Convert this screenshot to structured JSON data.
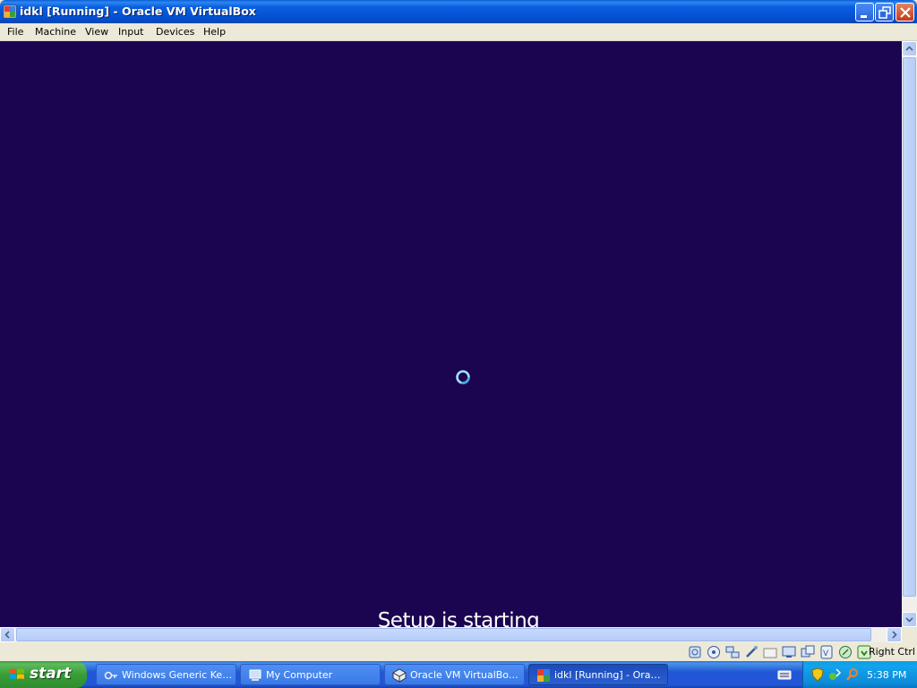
{
  "window": {
    "title": "idkl [Running] - Oracle VM VirtualBox",
    "menu": [
      "File",
      "Machine",
      "View",
      "Input",
      "Devices",
      "Help"
    ]
  },
  "vm": {
    "status_text": "Setup is starting",
    "background_color": "#1b0450"
  },
  "statusbar": {
    "icons": [
      "hard-disk-icon",
      "optical-drive-icon",
      "network-icon",
      "usb-icon",
      "shared-folders-icon",
      "display-icon",
      "capture-icon",
      "cpu-icon",
      "mouse-integration-icon",
      "keyboard-icon"
    ],
    "host_key": "Right Ctrl"
  },
  "taskbar": {
    "start_label": "start",
    "tasks": [
      {
        "label": "Windows Generic Key...",
        "icon": "key-icon"
      },
      {
        "label": "My Computer",
        "icon": "computer-icon"
      },
      {
        "label": "Oracle VM VirtualBox ...",
        "icon": "virtualbox-icon"
      },
      {
        "label": "idkl [Running] - Oracl...",
        "icon": "vm-window-icon",
        "active": true
      }
    ],
    "clock": "5:38 PM"
  }
}
